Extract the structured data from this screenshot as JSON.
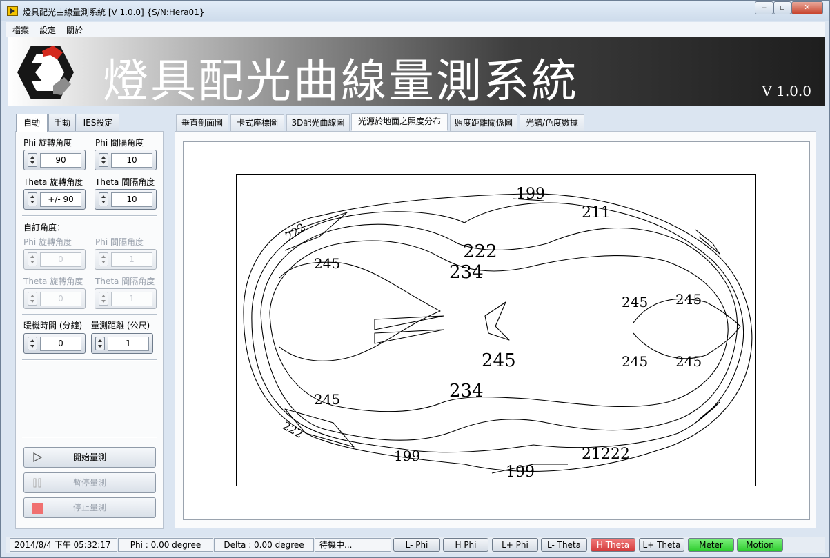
{
  "window": {
    "title": "燈具配光曲線量測系統 [V 1.0.0] {S/N:Hera01}"
  },
  "menu": [
    "檔案",
    "設定",
    "關於"
  ],
  "banner": {
    "title": "燈具配光曲線量測系統",
    "version": "V 1.0.0"
  },
  "left_tabs": [
    "自動",
    "手動",
    "IES設定"
  ],
  "auto": {
    "phi_rotate_label": "Phi 旋轉角度",
    "phi_rotate_value": "90",
    "phi_interval_label": "Phi 間隔角度",
    "phi_interval_value": "10",
    "theta_rotate_label": "Theta 旋轉角度",
    "theta_rotate_value": "+/- 90",
    "theta_interval_label": "Theta 間隔角度",
    "theta_interval_value": "10",
    "custom_label": "自訂角度：",
    "c_phi_rotate_label": "Phi 旋轉角度",
    "c_phi_rotate_value": "0",
    "c_phi_interval_label": "Phi 間隔角度",
    "c_phi_interval_value": "1",
    "c_theta_rotate_label": "Theta 旋轉角度",
    "c_theta_rotate_value": "0",
    "c_theta_interval_label": "Theta 間隔角度",
    "c_theta_interval_value": "1",
    "warmup_label": "暖機時間 (分鐘)",
    "warmup_value": "0",
    "distance_label": "量測距離 (公尺)",
    "distance_value": "1"
  },
  "buttons": {
    "start": "開始量測",
    "pause": "暫停量測",
    "stop": "停止量測"
  },
  "right_tabs": [
    "垂直剖面圖",
    "卡式座標圖",
    "3D配光曲線圖",
    "光源於地面之照度分布",
    "照度距離關係圖",
    "光譜/色度數據"
  ],
  "chart_data": {
    "type": "contour",
    "contour_labels": [
      "199",
      "211",
      "222",
      "234",
      "245",
      "245",
      "245",
      "245",
      "245",
      "245",
      "245",
      "234",
      "21222",
      "199",
      "199",
      "222",
      "222"
    ],
    "levels": [
      199,
      211,
      222,
      234,
      245
    ]
  },
  "status": {
    "datetime": "2014/8/4 下午 05:32:17",
    "phi": "Phi : 0.00 degree",
    "delta": "Delta : 0.00 degree",
    "state": "待機中..."
  },
  "indicators": [
    {
      "label": "L- Phi",
      "state": "off"
    },
    {
      "label": "H Phi",
      "state": "off"
    },
    {
      "label": "L+ Phi",
      "state": "off"
    },
    {
      "label": "L- Theta",
      "state": "off"
    },
    {
      "label": "H Theta",
      "state": "red"
    },
    {
      "label": "L+ Theta",
      "state": "off"
    },
    {
      "label": "Meter",
      "state": "green"
    },
    {
      "label": "Motion",
      "state": "green"
    }
  ],
  "colors": {
    "active_red": "#d43c3c",
    "active_green": "#2ecc2e",
    "logo_red": "#d42a1e"
  }
}
